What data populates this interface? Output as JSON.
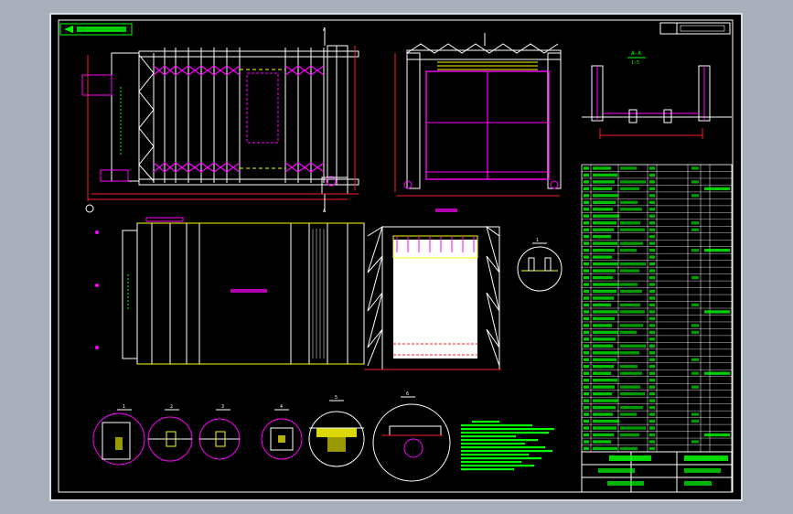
{
  "colors": {
    "background": "#000000",
    "canvas_margin": "#a9afba",
    "frame": "#d8dce4",
    "white": "#ffffff",
    "magenta": "#ff00ff",
    "yellow": "#ffff00",
    "red": "#ff2020",
    "green": "#00ff00",
    "cyan": "#00e0ff"
  },
  "labels": {
    "section_aa": "A-A",
    "section_aa_scale": "1:5",
    "section_marker_a": "A",
    "detail_1": "1",
    "detail_2": "2",
    "detail_3": "3",
    "detail_4": "4",
    "detail_5": "5",
    "detail_6": "6",
    "detail_scale": "1:5",
    "detail_top_scale": "1:10",
    "circle_marker": "1"
  },
  "parts_table": {
    "row_count": 42
  },
  "icons": {
    "compass": "north-arrow-icon",
    "datum": "datum-circle-icon"
  }
}
